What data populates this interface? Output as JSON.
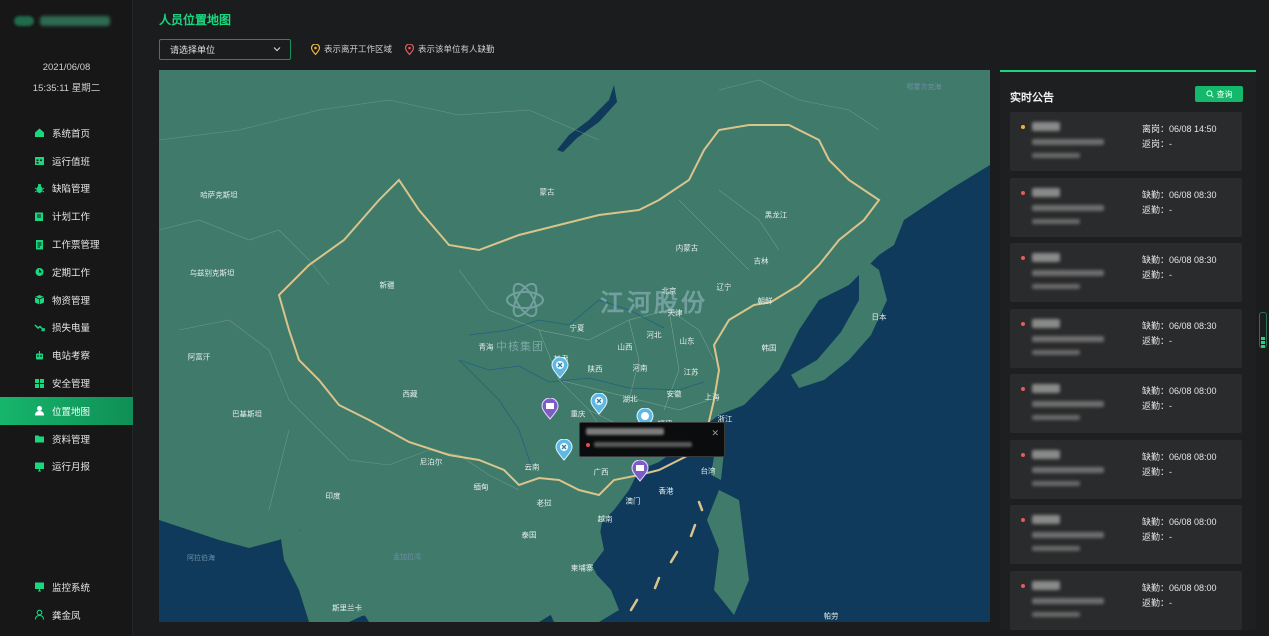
{
  "sidebar": {
    "date": "2021/06/08",
    "time": "15:35:11 星期二",
    "items": [
      {
        "label": "系统首页",
        "icon": "home-icon"
      },
      {
        "label": "运行值班",
        "icon": "calendar-grid-icon"
      },
      {
        "label": "缺陷管理",
        "icon": "bug-icon"
      },
      {
        "label": "计划工作",
        "icon": "plan-edit-icon"
      },
      {
        "label": "工作票管理",
        "icon": "ticket-doc-icon"
      },
      {
        "label": "定期工作",
        "icon": "alarm-clock-icon"
      },
      {
        "label": "物资管理",
        "icon": "box-icon"
      },
      {
        "label": "损失电量",
        "icon": "trend-down-icon"
      },
      {
        "label": "电站考察",
        "icon": "robot-icon"
      },
      {
        "label": "安全管理",
        "icon": "grid-squares-icon"
      },
      {
        "label": "位置地图",
        "icon": "user-location-icon",
        "active": true
      },
      {
        "label": "资料管理",
        "icon": "folder-icon"
      },
      {
        "label": "运行月报",
        "icon": "monitor-report-icon"
      }
    ],
    "bottom": [
      {
        "label": "监控系统",
        "icon": "monitor-icon"
      },
      {
        "label": "龚金凤",
        "icon": "user-icon"
      }
    ]
  },
  "header": {
    "title": "人员位置地图",
    "select_placeholder": "请选择单位",
    "legend": [
      {
        "text": "表示离开工作区域",
        "color": "#e9b53c"
      },
      {
        "text": "表示该单位有人缺勤",
        "color": "#e45b5b"
      }
    ]
  },
  "map": {
    "regions": [
      "哈萨克斯坦",
      "蒙古",
      "黑龙江",
      "乌兹别克斯坦",
      "新疆",
      "内蒙古",
      "吉林",
      "北京",
      "辽宁",
      "朝鲜",
      "宁夏",
      "天津",
      "日本",
      "山西",
      "河北",
      "阿富汗",
      "青海",
      "山东",
      "韩国",
      "甘肃",
      "陕西",
      "河南",
      "江苏",
      "西藏",
      "巴基斯坦",
      "湖北",
      "安徽",
      "上海",
      "重庆",
      "浙江",
      "福建",
      "广西",
      "云南",
      "台湾",
      "尼泊尔",
      "印度",
      "缅甸",
      "澳门",
      "香港",
      "老挝",
      "越南",
      "泰国",
      "柬埔寨",
      "斯里兰卡",
      "鄂霍次克海",
      "阿拉伯海",
      "孟加拉湾",
      "帕劳"
    ],
    "watermark_company": "江河股份",
    "watermark_group": "中核集团"
  },
  "panel": {
    "title": "实时公告",
    "query_label": "查询",
    "cards": [
      {
        "dot_color": "#e9b53c",
        "status_label": "离岗：",
        "status_time": "06/08 14:50",
        "back_label": "返岗：",
        "back_value": "-"
      },
      {
        "dot_color": "#e45b5b",
        "status_label": "缺勤：",
        "status_time": "06/08 08:30",
        "back_label": "返勤：",
        "back_value": "-"
      },
      {
        "dot_color": "#e45b5b",
        "status_label": "缺勤：",
        "status_time": "06/08 08:30",
        "back_label": "返勤：",
        "back_value": "-"
      },
      {
        "dot_color": "#e45b5b",
        "status_label": "缺勤：",
        "status_time": "06/08 08:30",
        "back_label": "返勤：",
        "back_value": "-"
      },
      {
        "dot_color": "#e45b5b",
        "status_label": "缺勤：",
        "status_time": "06/08 08:00",
        "back_label": "返勤：",
        "back_value": "-"
      },
      {
        "dot_color": "#e45b5b",
        "status_label": "缺勤：",
        "status_time": "06/08 08:00",
        "back_label": "返勤：",
        "back_value": "-"
      },
      {
        "dot_color": "#e45b5b",
        "status_label": "缺勤：",
        "status_time": "06/08 08:00",
        "back_label": "返勤：",
        "back_value": "-"
      },
      {
        "dot_color": "#e45b5b",
        "status_label": "缺勤：",
        "status_time": "06/08 08:00",
        "back_label": "返勤：",
        "back_value": "-"
      }
    ]
  },
  "colors": {
    "accent": "#19d67f",
    "land": "#3f7a6a",
    "sea": "#0f3a5c",
    "border_china": "#d9c48c"
  }
}
